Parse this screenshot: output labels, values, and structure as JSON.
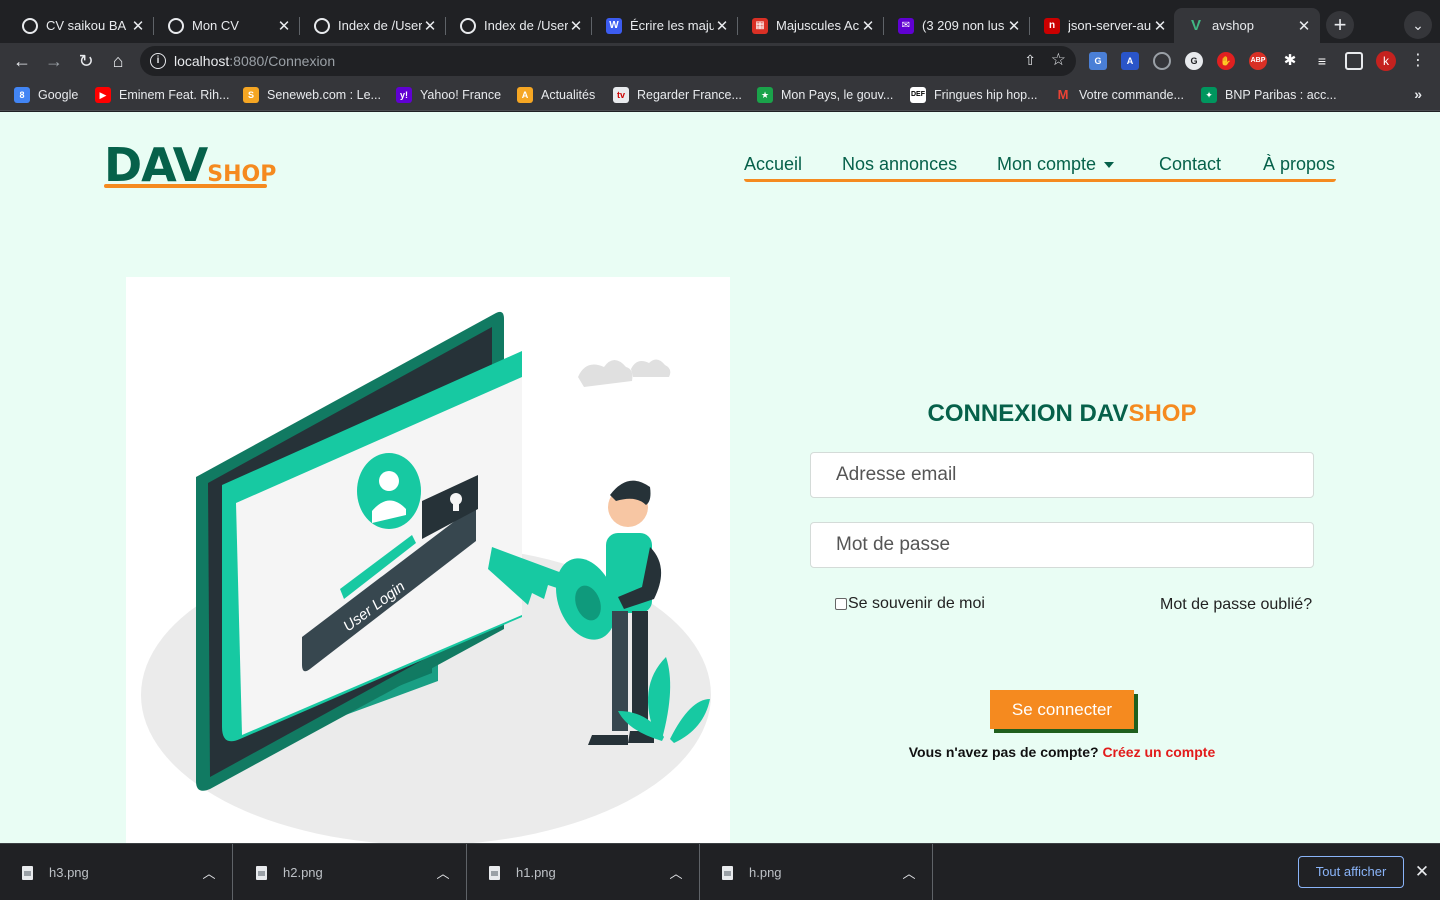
{
  "browser": {
    "tabs": [
      {
        "title": "CV saikou BA",
        "favicon": "globe-icon"
      },
      {
        "title": "Mon CV",
        "favicon": "globe-icon"
      },
      {
        "title": "Index de /User",
        "favicon": "globe-icon"
      },
      {
        "title": "Index de /User",
        "favicon": "globe-icon"
      },
      {
        "title": "Écrire les maju",
        "favicon": "document-icon"
      },
      {
        "title": "Majuscules Ac",
        "favicon": "calendar-icon"
      },
      {
        "title": "(3 209 non lus",
        "favicon": "mail-icon"
      },
      {
        "title": "json-server-au",
        "favicon": "npm-icon"
      },
      {
        "title": "avshop",
        "favicon": "vue-icon"
      }
    ],
    "url_host": "localhost",
    "url_path": ":8080/Connexion",
    "profile_initial": "k",
    "bookmarks": [
      {
        "label": "Google",
        "color": "#4285f4"
      },
      {
        "label": "Eminem Feat. Rih...",
        "color": "#ff0000"
      },
      {
        "label": "Seneweb.com : Le...",
        "color": "#f5a623"
      },
      {
        "label": "Yahoo! France",
        "color": "#6001d2"
      },
      {
        "label": "Actualités",
        "color": "#f5a623"
      },
      {
        "label": "Regarder France...",
        "color": "#e8eaed"
      },
      {
        "label": "Mon Pays, le gouv...",
        "color": "#1aa34a"
      },
      {
        "label": "Fringues hip hop...",
        "color": "#ffffff"
      },
      {
        "label": "Votre commande...",
        "color": "#ea4335"
      },
      {
        "label": "BNP Paribas : acc...",
        "color": "#00965e"
      }
    ]
  },
  "site": {
    "logo_main": "DAV",
    "logo_sub": "SHOP",
    "nav": [
      "Accueil",
      "Nos annonces",
      "Mon compte",
      "Contact",
      "À propos"
    ],
    "illustration_text": "User Login"
  },
  "login": {
    "title_part1": "CONNEXION DAV",
    "title_part2": "SHOP",
    "email_placeholder": "Adresse email",
    "password_placeholder": "Mot de passe",
    "remember_label": "Se souvenir de moi",
    "forgot_label": "Mot de passe oublié?",
    "submit_label": "Se connecter",
    "no_account_text": "Vous n'avez pas de compte?",
    "create_account_link": "Créez un compte"
  },
  "downloads": {
    "files": [
      "h3.png",
      "h2.png",
      "h1.png",
      "h.png"
    ],
    "show_all_label": "Tout afficher"
  },
  "colors": {
    "brand_green": "#06614a",
    "brand_orange": "#f58a1f",
    "page_bg": "#e9fdf4",
    "link_red": "#e21b1b"
  }
}
